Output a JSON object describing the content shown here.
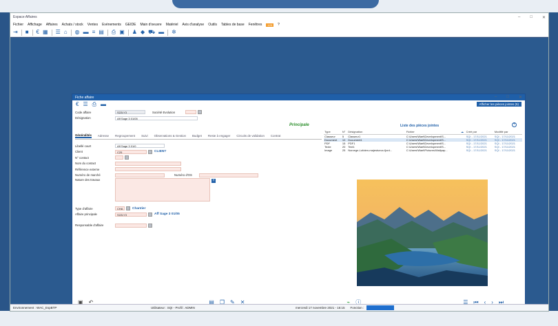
{
  "app": {
    "title": "Espace Affaires",
    "window_controls": [
      "–",
      "□",
      "✕"
    ]
  },
  "menu": [
    "Fichier",
    "Affichage",
    "Affaires",
    "Achats / stock",
    "Ventes",
    "Evénements",
    "GEIDE",
    "Main d'oeuvre",
    "Matériel",
    "Avis d'analyse",
    "Outils",
    "Tables de base",
    "Fenêtres",
    "?"
  ],
  "menu_badge": "123",
  "toolbar_icons": [
    "exit-icon",
    "briefcase-icon",
    "euro-icon",
    "calendar-icon",
    "list-icon",
    "bank-icon",
    "globe-icon",
    "chat-icon",
    "stats-icon",
    "table-icon",
    "print-icon",
    "clipboard-icon",
    "users-icon",
    "tag-icon",
    "cart-icon",
    "folder-icon",
    "settings-icon"
  ],
  "statusbar": {
    "env": "Environnement : WAC_EspBTP",
    "user": "Utilisateur : SQI - Profil : ADMIN",
    "date": "mercredi 17 novembre 2021 - 16:15",
    "function_label": "Fonction :"
  },
  "window": {
    "title": "Fiche affaire",
    "attach_button": "Afficher les pièces jointes (5)",
    "principale": "Principale",
    "header": {
      "code_label": "Code affaire",
      "code_value": "S22LY3",
      "societe_label": "Société Evolution",
      "designation_label": "Désignation",
      "designation_value": "Aff Sage 3 01/05"
    },
    "tabs": [
      "Généralités",
      "Adresse",
      "Regroupement",
      "Suivi",
      "Observations & Gestion",
      "Budget",
      "Reste à engager",
      "Circuits de validation",
      "Contrat"
    ],
    "form": {
      "libelle_label": "Libellé court",
      "libelle_value": "Aff Sage 3 01/0",
      "client_label": "Client",
      "client_value": "C25",
      "client_link": "CLIENT",
      "contact_num_label": "N° contact",
      "contact_name_label": "Nom du contact",
      "ref_label": "Référence externe",
      "marche_label": "Numéro de marché",
      "ods_label": "Numéro d'OS",
      "nature_label": "Nature des travaux",
      "type_label": "Type d'affaire",
      "type_value": "CHA",
      "type_link": "Chantier",
      "principale_label": "Affaire principale",
      "principale_value": "S22LY3",
      "principale_link": "Aff Sage 3 01/05",
      "responsable_label": "Responsable d'affaire"
    },
    "attachments": {
      "title": "Liste des pièces jointes",
      "columns": [
        "Type",
        "N°",
        "Désignation",
        "Fichier",
        "",
        "Créé par",
        "Modifié par"
      ],
      "rows": [
        {
          "type": "Classeur",
          "num": "5",
          "designation": "Classeur1",
          "file": "C:\\Users\\Wael\\Development\\S...",
          "created": "SQI - 17/11/2021",
          "modified": "SQI - 17/11/2021"
        },
        {
          "type": "Document",
          "num": "10",
          "designation": "Document1",
          "file": "C:\\Users\\Wael\\Development\\S...",
          "created": "SQI - 17/11/2021",
          "modified": "SQI - 17/11/2021"
        },
        {
          "type": "PDF",
          "num": "15",
          "designation": "PDF1",
          "file": "C:\\Users\\Wael\\Development\\S...",
          "created": "SQI - 17/11/2021",
          "modified": "SQI - 17/11/2021"
        },
        {
          "type": "Texte",
          "num": "20",
          "designation": "Text1",
          "file": "C:\\Users\\Wael\\Development\\S...",
          "created": "SQI - 17/11/2021",
          "modified": "SQI - 17/11/2021"
        },
        {
          "type": "Image",
          "num": "25",
          "designation": "Norvege-Lofoten-majestueux-fjord...",
          "file": "C:\\Users\\Wael\\Pictures\\Wallpap...",
          "created": "SQI - 17/11/2021",
          "modified": "SQI - 17/11/2021"
        }
      ]
    }
  }
}
